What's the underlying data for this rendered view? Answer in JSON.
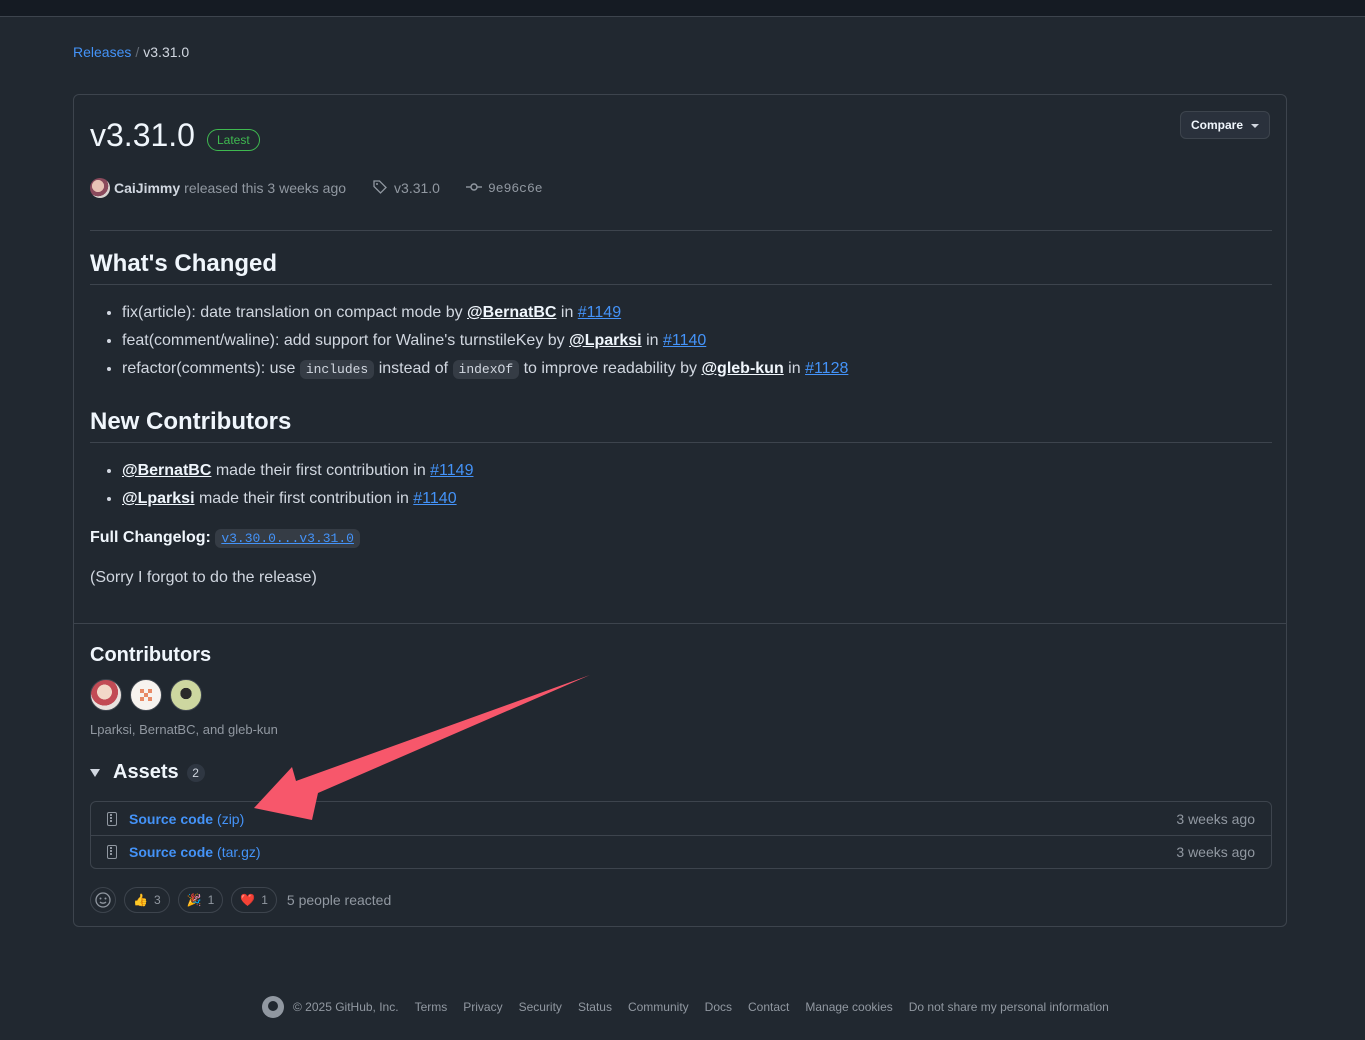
{
  "breadcrumb": {
    "parent": "Releases",
    "separator": "/",
    "current": "v3.31.0"
  },
  "release": {
    "title": "v3.31.0",
    "badge": "Latest",
    "compare_label": "Compare",
    "author": "CaiJimmy",
    "released_text": "released this 3 weeks ago",
    "tag": "v3.31.0",
    "commit": "9e96c6e"
  },
  "whats_changed": {
    "heading": "What's Changed",
    "items": [
      {
        "text": "fix(article): date translation on compact mode by ",
        "mention": "@BernatBC",
        "in": " in ",
        "issue": "#1149"
      },
      {
        "text": "feat(comment/waline): add support for Waline's turnstileKey by ",
        "mention": "@Lparksi",
        "in": " in ",
        "issue": "#1140"
      },
      {
        "pre": "refactor(comments): use ",
        "code1": "includes",
        "mid": " instead of ",
        "code2": "indexOf",
        "text": " to improve readability by ",
        "mention": "@gleb-kun",
        "in": " in ",
        "issue": "#1128"
      }
    ]
  },
  "new_contributors": {
    "heading": "New Contributors",
    "items": [
      {
        "mention": "@BernatBC",
        "text": " made their first contribution in ",
        "issue": "#1149"
      },
      {
        "mention": "@Lparksi",
        "text": " made their first contribution in ",
        "issue": "#1140"
      }
    ]
  },
  "changelog": {
    "label": "Full Changelog",
    "range": "v3.30.0...v3.31.0"
  },
  "note": "(Sorry I forgot to do the release)",
  "contributors": {
    "heading": "Contributors",
    "names": "Lparksi, BernatBC, and gleb-kun"
  },
  "assets": {
    "heading": "Assets",
    "count": "2",
    "rows": [
      {
        "name": "Source code",
        "ext": "(zip)",
        "date": "3 weeks ago"
      },
      {
        "name": "Source code",
        "ext": "(tar.gz)",
        "date": "3 weeks ago"
      }
    ]
  },
  "reactions": {
    "items": [
      {
        "emoji": "👍",
        "count": "3"
      },
      {
        "emoji": "🎉",
        "count": "1"
      },
      {
        "emoji": "❤️",
        "count": "1"
      }
    ],
    "summary": "5 people reacted"
  },
  "footer": {
    "copyright": "© 2025 GitHub, Inc.",
    "links": [
      "Terms",
      "Privacy",
      "Security",
      "Status",
      "Community",
      "Docs",
      "Contact",
      "Manage cookies",
      "Do not share my personal information"
    ]
  },
  "colors": {
    "background": "#212830",
    "accent": "#4493f8",
    "success": "#3fb950",
    "annotation_arrow": "#f7576b"
  }
}
